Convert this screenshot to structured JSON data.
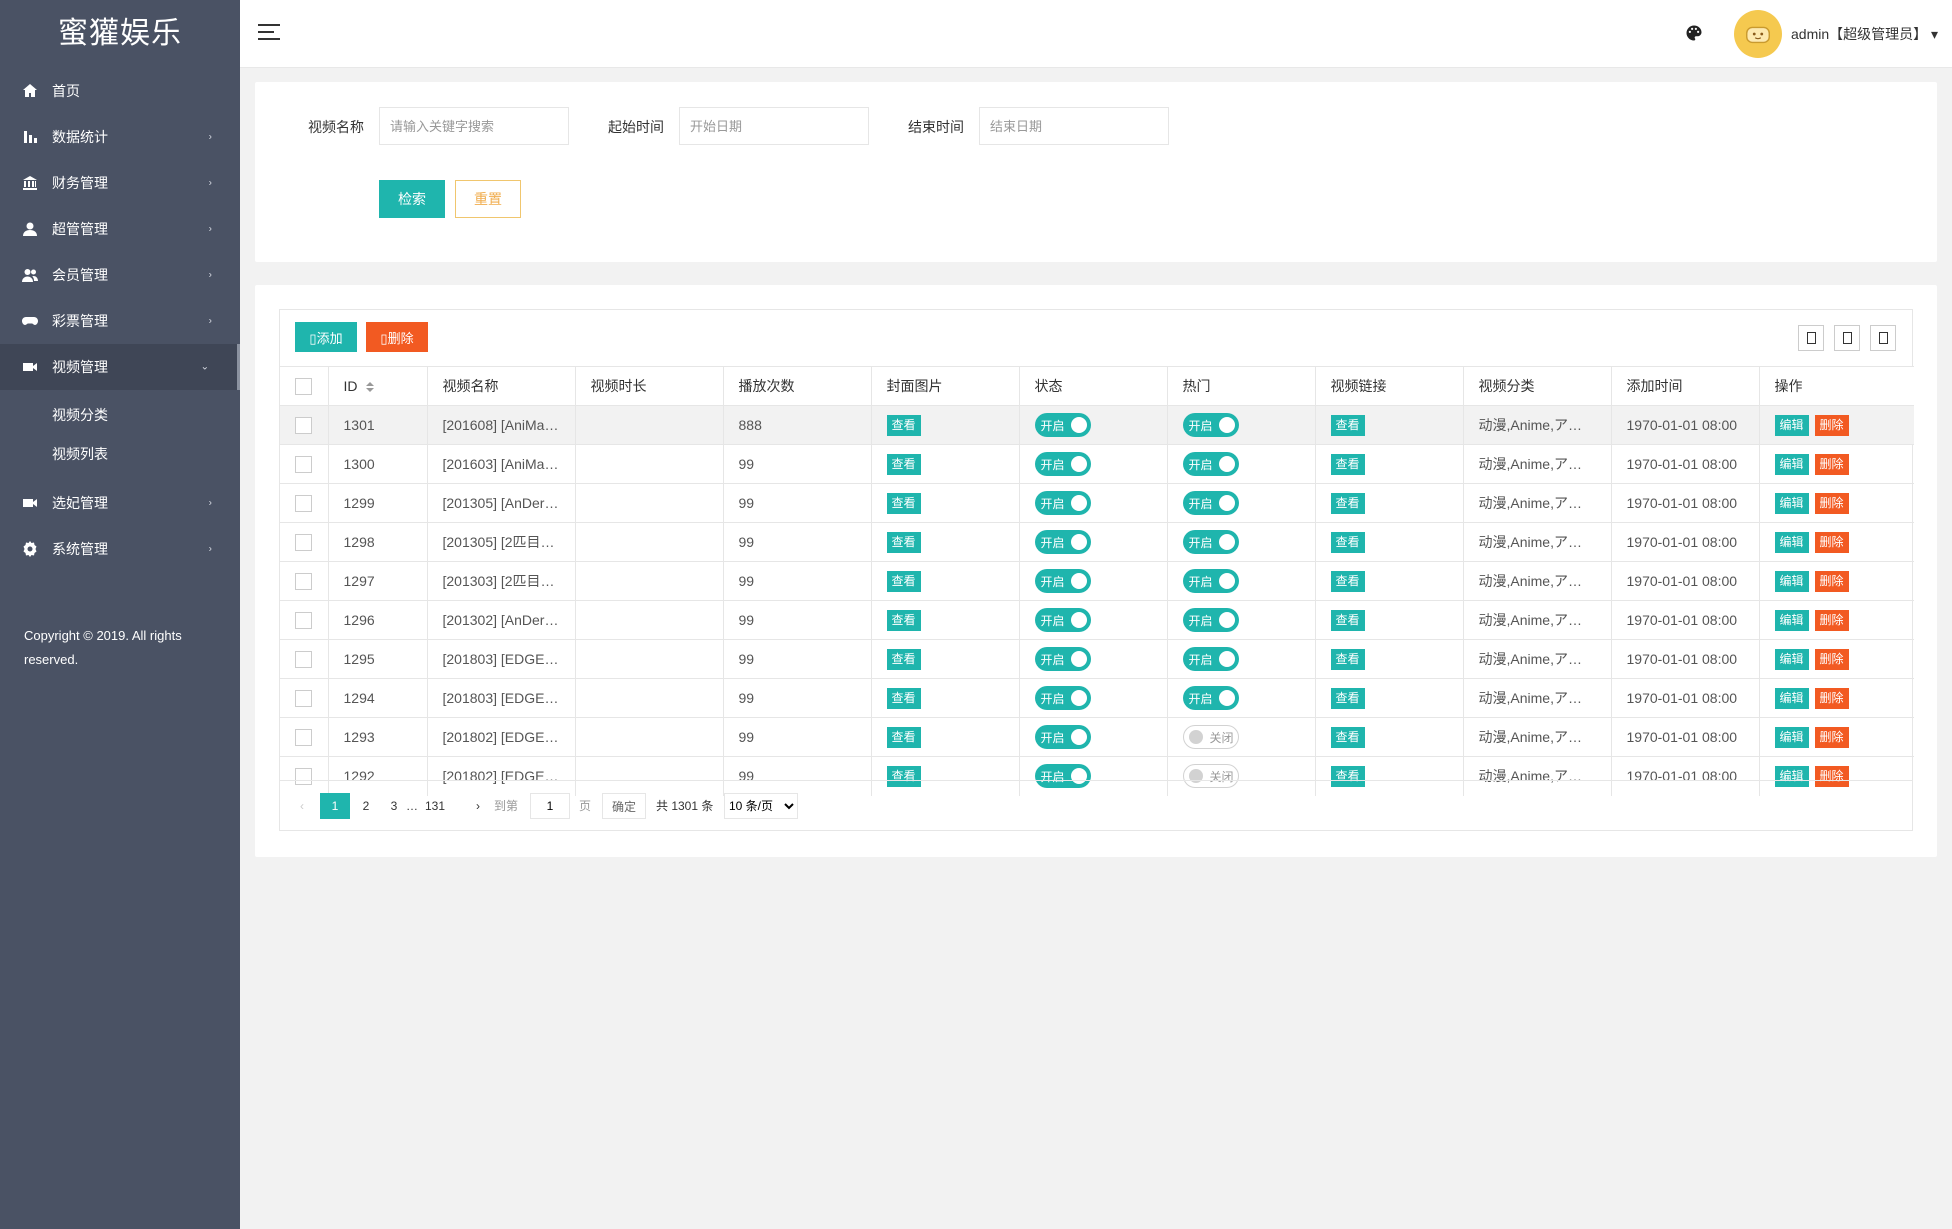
{
  "app": {
    "logo": "蜜獾娱乐"
  },
  "sidebar": {
    "items": [
      {
        "label": "首页",
        "icon": "home-icon",
        "arrow": ""
      },
      {
        "label": "数据统计",
        "icon": "bar-chart-icon",
        "arrow": "›"
      },
      {
        "label": "财务管理",
        "icon": "bank-icon",
        "arrow": "›"
      },
      {
        "label": "超管管理",
        "icon": "user-icon",
        "arrow": "›"
      },
      {
        "label": "会员管理",
        "icon": "users-icon",
        "arrow": "›"
      },
      {
        "label": "彩票管理",
        "icon": "gamepad-icon",
        "arrow": "›"
      },
      {
        "label": "视频管理",
        "icon": "video-icon",
        "arrow": "⌄"
      },
      {
        "label": "选妃管理",
        "icon": "video-icon",
        "arrow": "›"
      },
      {
        "label": "系统管理",
        "icon": "gear-icon",
        "arrow": "›"
      }
    ],
    "sub_items": [
      "视频分类",
      "视频列表"
    ],
    "copyright": "Copyright © 2019. All rights reserved."
  },
  "header": {
    "user": "admin【超级管理员】",
    "caret": "▾"
  },
  "search": {
    "name_label": "视频名称",
    "name_placeholder": "请输入关键字搜索",
    "start_label": "起始时间",
    "start_placeholder": "开始日期",
    "end_label": "结束时间",
    "end_placeholder": "结束日期",
    "search_button": "检索",
    "reset_button": "重置"
  },
  "toolbar": {
    "add_label": "添加",
    "delete_label": "删除"
  },
  "table": {
    "columns": [
      "ID",
      "视频名称",
      "视频时长",
      "播放次数",
      "封面图片",
      "状态",
      "热门",
      "视频链接",
      "视频分类",
      "添加时间",
      "操作"
    ],
    "view_label": "查看",
    "edit_label": "编辑",
    "remove_label": "删除",
    "on_label": "开启",
    "off_label": "关闭",
    "rows": [
      {
        "id": "1301",
        "name": "[201608] [AniMa…",
        "duration": "",
        "plays": "888",
        "status": true,
        "hot": true,
        "category": "动漫,Anime,ア…",
        "time": "1970-01-01 08:00"
      },
      {
        "id": "1300",
        "name": "[201603] [AniMa…",
        "duration": "",
        "plays": "99",
        "status": true,
        "hot": true,
        "category": "动漫,Anime,ア…",
        "time": "1970-01-01 08:00"
      },
      {
        "id": "1299",
        "name": "[201305] [AnDer…",
        "duration": "",
        "plays": "99",
        "status": true,
        "hot": true,
        "category": "动漫,Anime,ア…",
        "time": "1970-01-01 08:00"
      },
      {
        "id": "1298",
        "name": "[201305] [2匹目…",
        "duration": "",
        "plays": "99",
        "status": true,
        "hot": true,
        "category": "动漫,Anime,ア…",
        "time": "1970-01-01 08:00"
      },
      {
        "id": "1297",
        "name": "[201303] [2匹目…",
        "duration": "",
        "plays": "99",
        "status": true,
        "hot": true,
        "category": "动漫,Anime,ア…",
        "time": "1970-01-01 08:00"
      },
      {
        "id": "1296",
        "name": "[201302] [AnDer…",
        "duration": "",
        "plays": "99",
        "status": true,
        "hot": true,
        "category": "动漫,Anime,ア…",
        "time": "1970-01-01 08:00"
      },
      {
        "id": "1295",
        "name": "[201803] [EDGE…",
        "duration": "",
        "plays": "99",
        "status": true,
        "hot": true,
        "category": "动漫,Anime,ア…",
        "time": "1970-01-01 08:00"
      },
      {
        "id": "1294",
        "name": "[201803] [EDGE…",
        "duration": "",
        "plays": "99",
        "status": true,
        "hot": true,
        "category": "动漫,Anime,ア…",
        "time": "1970-01-01 08:00"
      },
      {
        "id": "1293",
        "name": "[201802] [EDGE…",
        "duration": "",
        "plays": "99",
        "status": true,
        "hot": false,
        "category": "动漫,Anime,ア…",
        "time": "1970-01-01 08:00"
      },
      {
        "id": "1292",
        "name": "[201802] [EDGE…",
        "duration": "",
        "plays": "99",
        "status": true,
        "hot": false,
        "category": "动漫,Anime,ア…",
        "time": "1970-01-01 08:00"
      }
    ]
  },
  "pagination": {
    "prev": "‹",
    "pages": [
      "1",
      "2",
      "3"
    ],
    "ellipsis": "…",
    "last": "131",
    "next": "›",
    "goto_label": "到第",
    "goto_value": "1",
    "page_unit": "页",
    "confirm": "确定",
    "total": "共 1301 条",
    "page_size": "10 条/页"
  },
  "colors": {
    "sidebar": "#4a5264",
    "accent": "#1fb5ad",
    "danger": "#f25a22",
    "warning": "#f0ad4e"
  }
}
